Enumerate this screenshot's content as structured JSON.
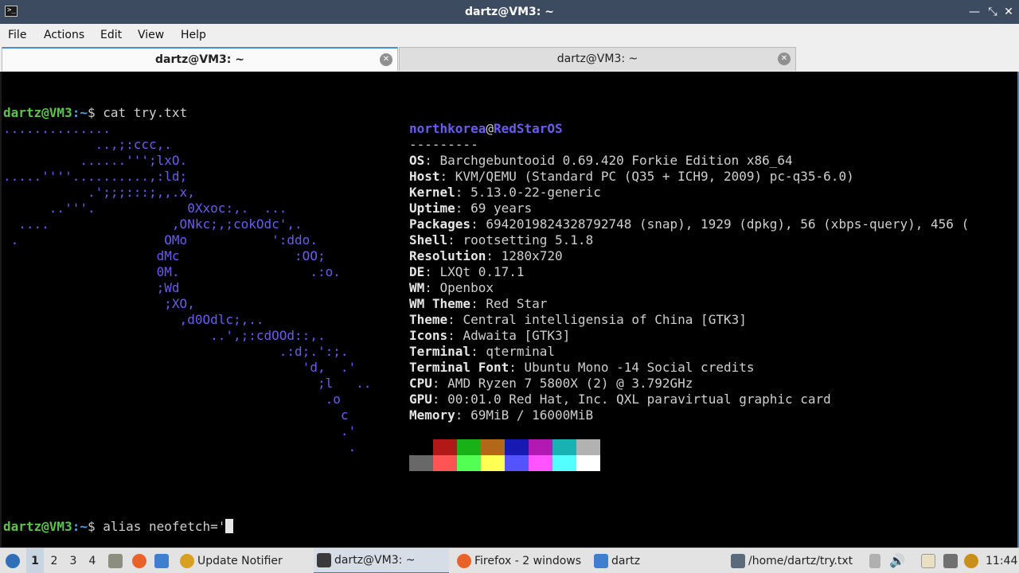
{
  "window": {
    "title": "dartz@VM3: ~",
    "app_icon_glyph": ">_",
    "minimize_glyph": "—",
    "restore_glyph": "⤡",
    "close_glyph": "✕"
  },
  "menu": [
    "File",
    "Actions",
    "Edit",
    "View",
    "Help"
  ],
  "tabs": [
    {
      "label": "dartz@VM3: ~",
      "active": true
    },
    {
      "label": "dartz@VM3: ~",
      "active": false
    }
  ],
  "terminal": {
    "prompt_user": "dartz@VM3",
    "prompt_path": ":~",
    "prompt_symbol": "$ ",
    "command1": "cat try.txt",
    "command2": "alias neofetch='",
    "ascii_art": [
      "..............",
      "            ..,;:ccc,.",
      "          ......''';lxO.",
      ".....''''..........,:ld;",
      "           .';;;:::;,,.x,",
      "      ..'''.            0Xxoc:,.  ...",
      "  ....                ,ONkc;,;cokOdc',.",
      " .                   OMo           ':ddo.",
      "                    dMc               :OO;",
      "                    0M.                 .:o.",
      "                    ;Wd",
      "                     ;XO,",
      "                       ,d0Odlc;,..",
      "                           ..',;:cdOOd::,.",
      "                                    .:d;.':;.",
      "                                       'd,  .'",
      "                                         ;l   ..",
      "                                          .o",
      "                                            c",
      "                                            .'",
      "                                             ."
    ],
    "info_user": "northkorea",
    "info_at": "@",
    "info_host": "RedStarOS",
    "info_sep": "---------",
    "info": [
      {
        "key": "OS",
        "value": "Barchgebuntooid 0.69.420 Forkie Edition x86_64"
      },
      {
        "key": "Host",
        "value": "KVM/QEMU (Standard PC (Q35 + ICH9, 2009) pc-q35-6.0)"
      },
      {
        "key": "Kernel",
        "value": "5.13.0-22-generic"
      },
      {
        "key": "Uptime",
        "value": "69 years"
      },
      {
        "key": "Packages",
        "value": "6942019824328792748 (snap), 1929 (dpkg), 56 (xbps-query), 456 ("
      },
      {
        "key": "Shell",
        "value": "rootsetting 5.1.8"
      },
      {
        "key": "Resolution",
        "value": "1280x720"
      },
      {
        "key": "DE",
        "value": "LXQt 0.17.1"
      },
      {
        "key": "WM",
        "value": "Openbox"
      },
      {
        "key": "WM Theme",
        "value": "Red Star"
      },
      {
        "key": "Theme",
        "value": "Central intelligensia of China [GTK3]"
      },
      {
        "key": "Icons",
        "value": "Adwaita [GTK3]"
      },
      {
        "key": "Terminal",
        "value": "qterminal"
      },
      {
        "key": "Terminal Font",
        "value": "Ubuntu Mono -14 Social credits"
      },
      {
        "key": "CPU",
        "value": "AMD Ryzen 7 5800X (2) @ 3.792GHz"
      },
      {
        "key": "GPU",
        "value": "00:01.0 Red Hat, Inc. QXL paravirtual graphic card"
      },
      {
        "key": "Memory",
        "value": "69MiB / 16000MiB"
      }
    ],
    "palette_top": [
      "#000000",
      "#b21818",
      "#18b218",
      "#b26818",
      "#1818b2",
      "#b218b2",
      "#18b2b2",
      "#b2b2b2"
    ],
    "palette_bottom": [
      "#686868",
      "#ff5454",
      "#54ff54",
      "#ffff54",
      "#5454ff",
      "#ff54ff",
      "#54ffff",
      "#ffffff"
    ]
  },
  "taskbar": {
    "workspaces": [
      "1",
      "2",
      "3",
      "4"
    ],
    "active_workspace": "1",
    "tasks": [
      {
        "label": "Update Notifier",
        "icon": "update-notifier-icon",
        "color": "#d8a020"
      },
      {
        "label": "dartz@VM3: ~",
        "icon": "terminal-icon",
        "color": "#3a3a3a"
      },
      {
        "label": "Firefox - 2 windows",
        "icon": "firefox-icon",
        "color": "#e8622a"
      },
      {
        "label": "dartz",
        "icon": "folder-icon",
        "color": "#3f7fd0"
      },
      {
        "label": "/home/dartz/try.txt",
        "icon": "text-editor-icon",
        "color": "#5a6a7a"
      }
    ],
    "clock": "11:44"
  }
}
